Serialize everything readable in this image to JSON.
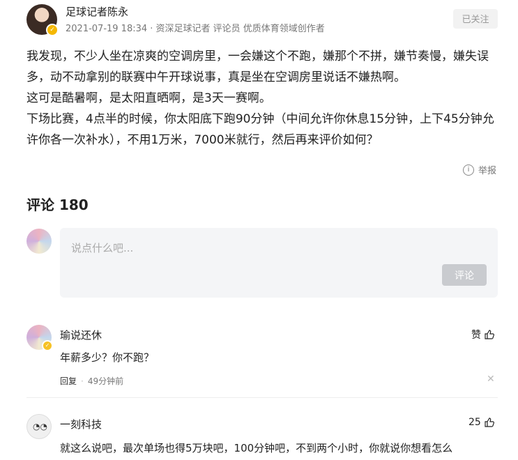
{
  "author": {
    "name": "足球记者陈永",
    "meta": "2021-07-19 18:34 · 资深足球记者 评论员 优质体育领域创作者",
    "follow_label": "已关注"
  },
  "article": {
    "paragraphs": [
      "我发现，不少人坐在凉爽的空调房里，一会嫌这个不跑，嫌那个不拼，嫌节奏慢，嫌失误多，动不动拿别的联赛中午开球说事，真是坐在空调房里说话不嫌热啊。",
      "这可是酷暑啊，是太阳直晒啊，是3天一赛啊。",
      "下场比赛，4点半的时候，你太阳底下跑90分钟（中间允许你休息15分钟，上下45分钟允许你各一次补水），不用1万米，7000米就行，然后再来评价如何？"
    ]
  },
  "report_label": "举报",
  "comments_section": {
    "title": "评论 180",
    "input_placeholder": "说点什么吧...",
    "submit_label": "评论"
  },
  "comments": [
    {
      "user": "瑜说还休",
      "text": "年薪多少？你不跑？",
      "like_label": "赞",
      "reply_label": "回复",
      "time": "49分钟前"
    },
    {
      "user": "一刻科技",
      "text": "就这么说吧，最次单场也得5万块吧，100分钟吧，不到两个小时，你就说你想看怎么",
      "like_count": "25"
    }
  ]
}
